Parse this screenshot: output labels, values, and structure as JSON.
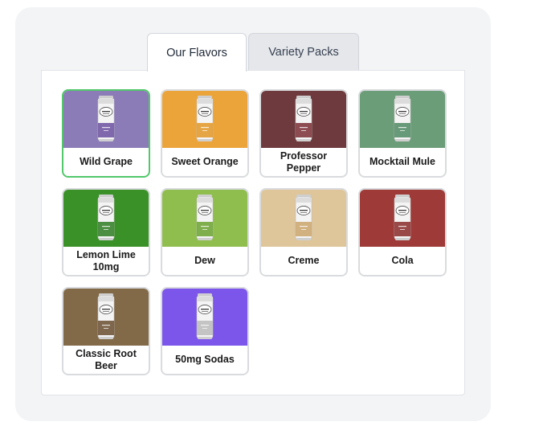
{
  "tabs": [
    {
      "label": "Our Flavors",
      "active": true
    },
    {
      "label": "Variety Packs",
      "active": false
    }
  ],
  "flavors": [
    {
      "label": "Wild Grape",
      "color": "#8b7cb8",
      "accent": "#6b4fa0",
      "selected": true
    },
    {
      "label": "Sweet Orange",
      "color": "#eba43a",
      "accent": "#e39624",
      "selected": false
    },
    {
      "label": "Professor Pepper",
      "color": "#6e3a3d",
      "accent": "#7a2e35",
      "selected": false
    },
    {
      "label": "Mocktail Mule",
      "color": "#6b9d78",
      "accent": "#4e8a62",
      "selected": false
    },
    {
      "label": "Lemon Lime 10mg",
      "color": "#3a9128",
      "accent": "#2f7d22",
      "selected": false
    },
    {
      "label": "Dew",
      "color": "#8fbd4e",
      "accent": "#6aa12f",
      "selected": false
    },
    {
      "label": "Creme",
      "color": "#dec59a",
      "accent": "#caa56a",
      "selected": false
    },
    {
      "label": "Cola",
      "color": "#9e3a37",
      "accent": "#8a2a2a",
      "selected": false
    },
    {
      "label": "Classic Root Beer",
      "color": "#826a48",
      "accent": "#6a4e30",
      "selected": false
    },
    {
      "label": "50mg Sodas",
      "color": "#7c56ea",
      "accent": "#ffffff",
      "selected": false
    }
  ],
  "icons": {
    "flavor_image": "soda-can-icon"
  }
}
